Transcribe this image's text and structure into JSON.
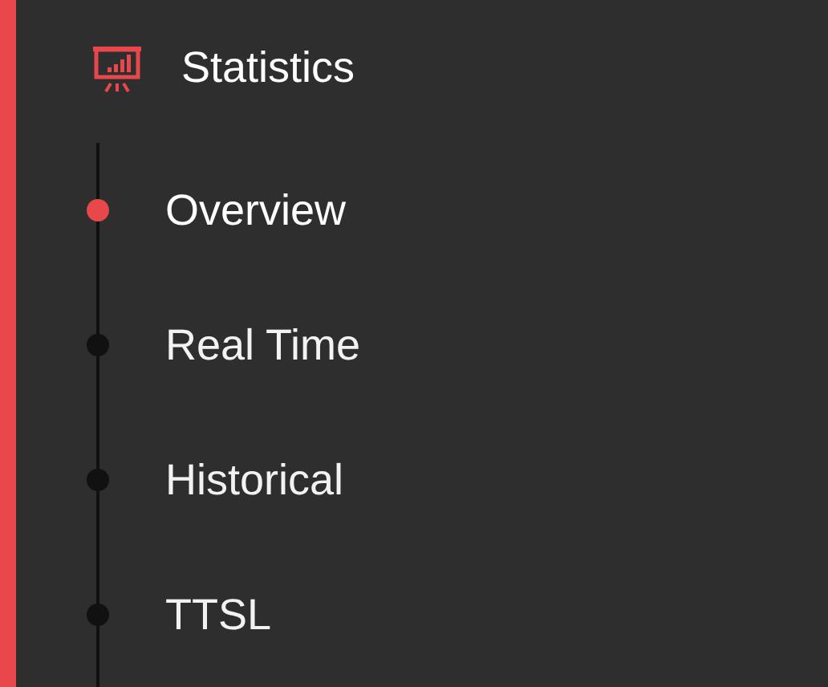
{
  "section": {
    "title": "Statistics",
    "active": true
  },
  "items": [
    {
      "label": "Overview",
      "selected": true
    },
    {
      "label": "Real Time",
      "selected": false
    },
    {
      "label": "Historical",
      "selected": false
    },
    {
      "label": "TTSL",
      "selected": false
    }
  ]
}
